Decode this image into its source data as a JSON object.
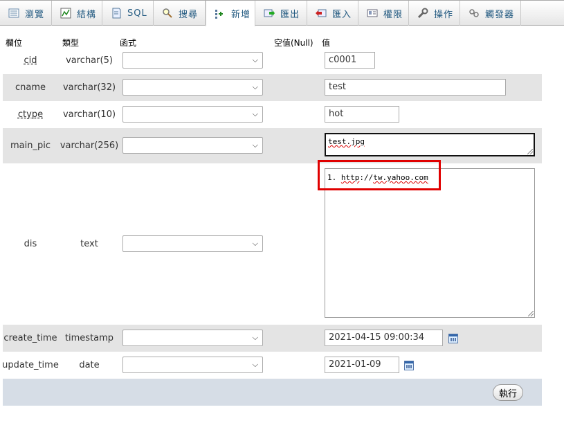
{
  "tabs": [
    {
      "label": "瀏覽",
      "icon": "browse-icon"
    },
    {
      "label": "結構",
      "icon": "structure-icon"
    },
    {
      "label": "SQL",
      "icon": "sql-icon"
    },
    {
      "label": "搜尋",
      "icon": "search-icon"
    },
    {
      "label": "新增",
      "icon": "insert-icon",
      "active": true
    },
    {
      "label": "匯出",
      "icon": "export-icon"
    },
    {
      "label": "匯入",
      "icon": "import-icon"
    },
    {
      "label": "權限",
      "icon": "privileges-icon"
    },
    {
      "label": "操作",
      "icon": "operations-icon"
    },
    {
      "label": "觸發器",
      "icon": "triggers-icon"
    }
  ],
  "headers": {
    "column": "欄位",
    "type": "類型",
    "function": "函式",
    "null": "空值(Null)",
    "value": "值"
  },
  "rows": [
    {
      "name": "cid",
      "type": "varchar(5)",
      "value": "c0001"
    },
    {
      "name": "cname",
      "type": "varchar(32)",
      "value": "test"
    },
    {
      "name": "ctype",
      "type": "varchar(10)",
      "value": "hot"
    },
    {
      "name": "main_pic",
      "type": "varchar(256)",
      "value": "test.jpg"
    },
    {
      "name": "dis",
      "type": "text",
      "value_prefix": "1. ",
      "value_link1": "http",
      "value_mid": "://",
      "value_link2": "tw.yahoo.com"
    },
    {
      "name": "create_time",
      "type": "timestamp",
      "value": "2021-04-15 09:00:34"
    },
    {
      "name": "update_time",
      "type": "date",
      "value": "2021-01-09"
    }
  ],
  "go_button": "執行",
  "colors": {
    "accent_tab_text": "#235a81",
    "row_shade": "#e4e4e4",
    "footer": "#d6dde6",
    "highlight": "#e00000"
  }
}
